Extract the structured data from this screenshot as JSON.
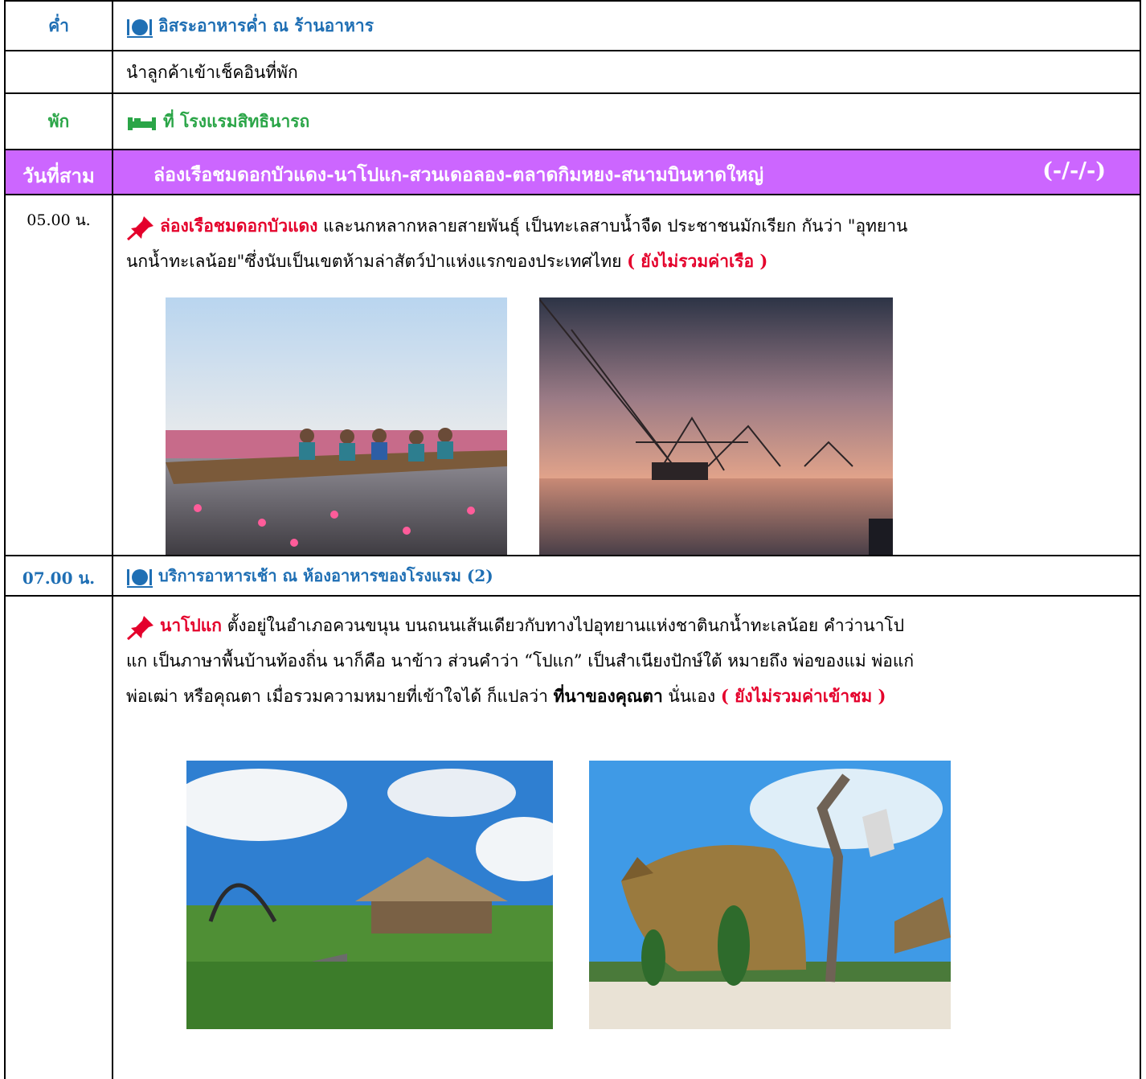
{
  "rows": {
    "dinner": {
      "time": "ค่ำ",
      "text": "อิสระอาหารค่ำ ณ ร้านอาหาร"
    },
    "checkin": {
      "text": "นำลูกค้าเข้าเช็คอินที่พัก"
    },
    "stay": {
      "time": "พัก",
      "text": "ที่ โรงแรมสิทธินารถ"
    },
    "day3": {
      "label": "วันที่สาม",
      "title": "ล่องเรือชมดอกบัวแดง-นาโปแก-สวนเดอลอง-ตลาดกิมหยง-สนามบินหาดใหญ่",
      "meals": "(-/-/-)"
    },
    "t0500": {
      "time": "05.00 น.",
      "highlight": "ล่องเรือชมดอกบัวแดง",
      "line1": " และนกหลากหลายสายพันธุ์ เป็นทะเลสาบน้ำจืด  ประชาชนมักเรียก กันว่า \"อุทยาน",
      "line2": "นกน้ำทะเลน้อย\"ซึ่งนับเป็นเขตห้ามล่าสัตว์ป่าแห่งแรกของประเทศไทย ",
      "note": "( ยังไม่รวมค่าเรือ )"
    },
    "t0700": {
      "time": "07.00 น.",
      "text": "บริการอาหารเช้า ณ ห้องอาหารของโรงแรม (2)"
    },
    "napokae": {
      "highlight": "นาโปแก",
      "line1": " ตั้งอยู่ในอำเภอควนขนุน บนถนนเส้นเดียวกับทางไปอุทยานแห่งชาตินกน้ำทะเลน้อย คำว่านาโป",
      "line2": "แก เป็นภาษาพื้นบ้านท้องถิ่น นาก็คือ นาข้าว ส่วนคำว่า “โปแก” เป็นสำเนียงปักษ์ใต้ หมายถึง พ่อของแม่ พ่อแก่",
      "line3a": "พ่อเฒ่า หรือคุณตา เมื่อรวมความหมายที่เข้าใจได้ ก็แปลว่า ",
      "bold": "ที่นาของคุณตา",
      "line3b": " นั่นเอง ",
      "note": "( ยังไม่รวมค่าเข้าชม )"
    }
  },
  "colors": {
    "blue": "#1f6fb4",
    "green": "#2aa547",
    "red": "#e4002b",
    "purple": "#cc66ff"
  },
  "icons": {
    "meal": "plate-cutlery-icon",
    "hotel": "bed-icon",
    "pin": "pushpin-icon"
  }
}
